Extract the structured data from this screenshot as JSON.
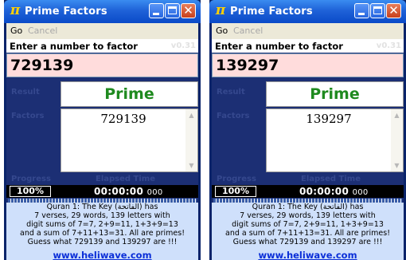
{
  "windows": [
    {
      "title": "Prime Factors",
      "app_icon_glyph": "π",
      "menu": {
        "go": "Go",
        "cancel": "Cancel"
      },
      "prompt": "Enter a number to factor",
      "version": "v0.31",
      "input_value": "729139",
      "result_label": "Result",
      "result_value": "Prime",
      "factors_label": "Factors",
      "factors_value": "729139",
      "progress_label": "Progress",
      "elapsed_label": "Elapsed Time",
      "progress_percent": "100%",
      "progress_fraction": 1.0,
      "elapsed_time": "00:00:00",
      "elapsed_ms": "000",
      "info_lines": [
        "Quran 1: The Key (الفاتحة) has",
        "7 verses, 29 words, 139 letters with",
        "digit sums of 7=7, 2+9=11, 1+3+9=13",
        "and a sum of 7+11+13=31. All are primes!",
        "Guess what 729139 and 139297 are !!!"
      ],
      "link": "www.heliwave.com"
    },
    {
      "title": "Prime Factors",
      "app_icon_glyph": "π",
      "menu": {
        "go": "Go",
        "cancel": "Cancel"
      },
      "prompt": "Enter a number to factor",
      "version": "v0.31",
      "input_value": "139297",
      "result_label": "Result",
      "result_value": "Prime",
      "factors_label": "Factors",
      "factors_value": "139297",
      "progress_label": "Progress",
      "elapsed_label": "Elapsed Time",
      "progress_percent": "100%",
      "progress_fraction": 1.0,
      "elapsed_time": "00:00:00",
      "elapsed_ms": "000",
      "info_lines": [
        "Quran 1: The Key (الفاتحة) has",
        "7 verses, 29 words, 139 letters with",
        "digit sums of 7=7, 2+9=11, 1+3+9=13",
        "and a sum of 7+11+13=31. All are primes!",
        "Guess what 729139 and 139297 are !!!"
      ],
      "link": "www.heliwave.com"
    }
  ],
  "colors": {
    "titlebar_blue": "#1f62d8",
    "result_green": "#1f8a1f",
    "input_pink": "#ffdcdc",
    "info_bg": "#cfe0fb",
    "link_blue": "#0b2fd8",
    "label_faded": "#35488e"
  },
  "icons": {
    "app": "pi-icon",
    "minimize": "minimize-icon",
    "maximize": "maximize-icon",
    "close": "close-icon",
    "scroll_up": "chevron-up-icon",
    "scroll_down": "chevron-down-icon"
  }
}
